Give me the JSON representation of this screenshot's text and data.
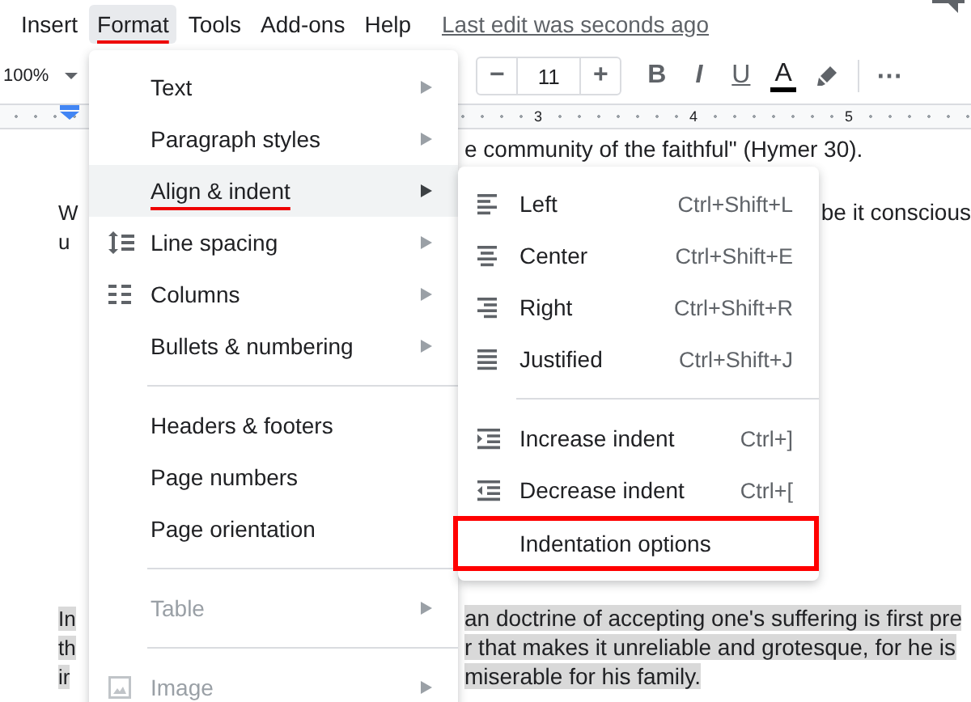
{
  "menubar": {
    "items": [
      {
        "label": "Insert",
        "selected": false,
        "annotated": false
      },
      {
        "label": "Format",
        "selected": true,
        "annotated": true
      },
      {
        "label": "Tools",
        "selected": false,
        "annotated": false
      },
      {
        "label": "Add-ons",
        "selected": false,
        "annotated": false
      },
      {
        "label": "Help",
        "selected": false,
        "annotated": false
      }
    ],
    "last_edit": "Last edit was seconds ago"
  },
  "toolbar": {
    "zoom": "100%",
    "minus": "−",
    "font_size": "11",
    "plus": "+",
    "bold": "B",
    "italic": "I",
    "underline": "U",
    "text_color": "A",
    "more": "⋯"
  },
  "ruler": {
    "labels": [
      "3",
      "4",
      "5"
    ]
  },
  "document": {
    "lines": [
      {
        "right": "e community of the faithful\" (Hymer 30).",
        "highlighted": false
      },
      {
        "left": "W",
        "right": "be it conscious",
        "highlighted": false
      },
      {
        "left": "u",
        "highlighted": false
      },
      {
        "left": "In",
        "right": "an doctrine of accepting one's suffering is first pre",
        "highlighted": true
      },
      {
        "left": "th",
        "right": "r that makes it unreliable and grotesque, for he is",
        "highlighted": true
      },
      {
        "left": "ir",
        "right": "miserable for his family.",
        "highlighted": true
      }
    ]
  },
  "format_menu": {
    "items": [
      {
        "kind": "item",
        "label": "Text",
        "submenu": true,
        "disabled": false,
        "selected": false,
        "annotated": false
      },
      {
        "kind": "item",
        "label": "Paragraph styles",
        "submenu": true,
        "disabled": false,
        "selected": false,
        "annotated": false
      },
      {
        "kind": "item",
        "label": "Align & indent",
        "submenu": true,
        "disabled": false,
        "selected": true,
        "annotated": true
      },
      {
        "kind": "spacing",
        "label": "Line spacing",
        "submenu": true,
        "disabled": false,
        "selected": false,
        "annotated": false
      },
      {
        "kind": "columns",
        "label": "Columns",
        "submenu": true,
        "disabled": false,
        "selected": false,
        "annotated": false
      },
      {
        "kind": "item",
        "label": "Bullets & numbering",
        "submenu": true,
        "disabled": false,
        "selected": false,
        "annotated": false
      },
      {
        "kind": "divider"
      },
      {
        "kind": "item",
        "label": "Headers & footers",
        "submenu": false,
        "disabled": false,
        "selected": false,
        "annotated": false
      },
      {
        "kind": "item",
        "label": "Page numbers",
        "submenu": false,
        "disabled": false,
        "selected": false,
        "annotated": false
      },
      {
        "kind": "item",
        "label": "Page orientation",
        "submenu": false,
        "disabled": false,
        "selected": false,
        "annotated": false
      },
      {
        "kind": "divider"
      },
      {
        "kind": "item",
        "label": "Table",
        "submenu": true,
        "disabled": true,
        "selected": false,
        "annotated": false
      },
      {
        "kind": "divider"
      },
      {
        "kind": "image",
        "label": "Image",
        "submenu": true,
        "disabled": true,
        "selected": false,
        "annotated": false
      }
    ]
  },
  "align_submenu": {
    "items": [
      {
        "kind": "left",
        "label": "Left",
        "shortcut": "Ctrl+Shift+L",
        "annotated": false
      },
      {
        "kind": "center",
        "label": "Center",
        "shortcut": "Ctrl+Shift+E",
        "annotated": false
      },
      {
        "kind": "right",
        "label": "Right",
        "shortcut": "Ctrl+Shift+R",
        "annotated": false
      },
      {
        "kind": "justify",
        "label": "Justified",
        "shortcut": "Ctrl+Shift+J",
        "annotated": false
      },
      {
        "kind": "divider"
      },
      {
        "kind": "indent",
        "label": "Increase indent",
        "shortcut": "Ctrl+]",
        "annotated": false
      },
      {
        "kind": "outdent",
        "label": "Decrease indent",
        "shortcut": "Ctrl+[",
        "annotated": false
      },
      {
        "kind": "plain",
        "label": "Indentation options",
        "annotated": true
      }
    ]
  }
}
